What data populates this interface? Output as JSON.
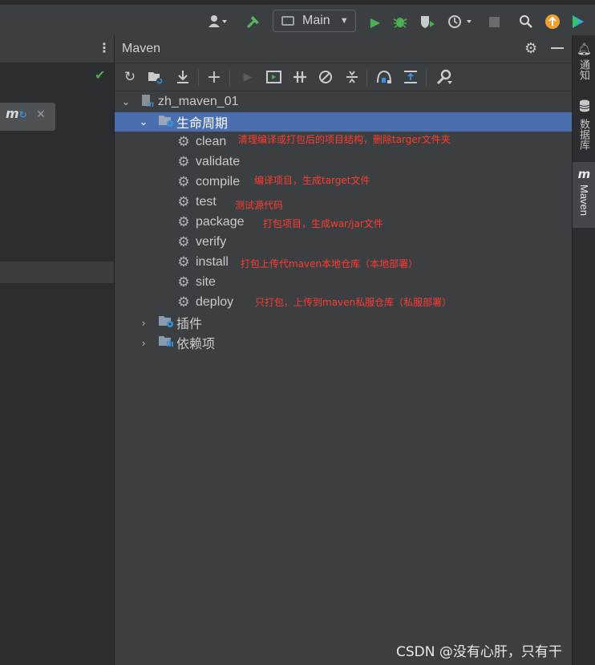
{
  "toolbar": {
    "run_config": "Main",
    "icons": [
      "user-icon",
      "build-hammer-icon",
      "run-icon",
      "debug-icon",
      "coverage-icon",
      "profile-icon",
      "stop-icon",
      "search-icon",
      "update-icon",
      "toolbox-icon"
    ],
    "colors": {
      "run": "#4caf50",
      "update": "#f0a030"
    }
  },
  "left_panel": {
    "tab_icon": "maven-refresh-icon"
  },
  "maven": {
    "title": "Maven",
    "project": "zh_maven_01",
    "lifecycle": {
      "label": "生命周期",
      "goals": [
        {
          "name": "clean",
          "note": "清理编译或打包后的项目结构，删除targer文件夹"
        },
        {
          "name": "validate",
          "note": ""
        },
        {
          "name": "compile",
          "note": "编译项目，生成target文件"
        },
        {
          "name": "test",
          "note": "测试源代码"
        },
        {
          "name": "package",
          "note": "打包项目，生成war/jar文件"
        },
        {
          "name": "verify",
          "note": ""
        },
        {
          "name": "install",
          "note": "打包上传代maven本地仓库（本地部署）"
        },
        {
          "name": "site",
          "note": ""
        },
        {
          "name": "deploy",
          "note": "只打包，上传到maven私服仓库（私服部署）"
        }
      ]
    },
    "plugins_label": "插件",
    "dependencies_label": "依赖项"
  },
  "right_strip": {
    "tabs": [
      {
        "label": "通知",
        "icon": "bell-icon"
      },
      {
        "label": "数据库",
        "icon": "database-icon"
      },
      {
        "label": "Maven",
        "icon": "maven-icon"
      }
    ]
  },
  "watermark": "CSDN @没有心肝，只有干"
}
